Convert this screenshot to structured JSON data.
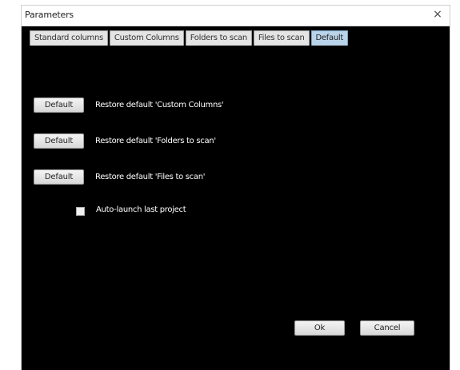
{
  "window": {
    "title": "Parameters",
    "close_glyph": "×"
  },
  "tabs": [
    {
      "label": "Standard columns",
      "active": false
    },
    {
      "label": "Custom Columns",
      "active": false
    },
    {
      "label": "Folders to scan",
      "active": false
    },
    {
      "label": "Files to scan",
      "active": false
    },
    {
      "label": "Default",
      "active": true
    }
  ],
  "defaults": [
    {
      "button_label": "Default",
      "description": "Restore default 'Custom Columns'"
    },
    {
      "button_label": "Default",
      "description": "Restore default 'Folders to scan'"
    },
    {
      "button_label": "Default",
      "description": "Restore default 'Files to scan'"
    }
  ],
  "auto_launch": {
    "label": "Auto-launch last project",
    "checked": false
  },
  "footer": {
    "ok_label": "Ok",
    "cancel_label": "Cancel"
  },
  "colors": {
    "panel_background": "#000000",
    "active_tab": "#b9d4ea"
  }
}
